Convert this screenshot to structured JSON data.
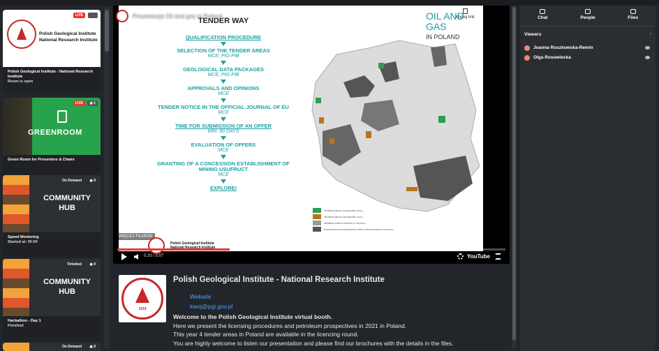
{
  "rail": {
    "cards": [
      {
        "title": "Polish Geological Institute - National Research Institute",
        "status": "Room is open",
        "badge": "LIVE",
        "count": "",
        "thumb_text": "Polish Geological Institute\nNational Research Institute"
      },
      {
        "title": "Green Room for Presenters & Chairs",
        "status": "",
        "badge": "LIVE",
        "count": "1",
        "thumb_text": "GREENROOM"
      },
      {
        "title": "Speed Mentoring",
        "status": "Started at: 00:00",
        "badge": "On Demand",
        "count": "0",
        "thumb_text": "COMMUNITY\nHUB"
      },
      {
        "title": "Hackathon - Day 1",
        "status": "Finished",
        "badge": "Finished",
        "count": "0",
        "thumb_text": "COMMUNITY\nHUB"
      },
      {
        "title": "",
        "status": "",
        "badge": "On Demand",
        "count": "0",
        "thumb_text": ""
      }
    ]
  },
  "video": {
    "yt_title": "Prezentacja Oil and gas in Poland",
    "copy_link": "Kopiuj link",
    "more_films": "WIĘCEJ FILMÓW",
    "time": "0:20 / 5:07",
    "progress_fraction": 0.29,
    "youtube": "YouTube",
    "corner_text": "Polish Geological Institute\nNational Research Institute",
    "slide": {
      "heading": "TENDER WAY",
      "brand_main": "OIL AND GAS",
      "brand_sub": "IN POLAND",
      "steps": [
        {
          "label": "QUALIFICATION PROCEDURE",
          "sub": "",
          "underline": true
        },
        {
          "label": "SELECTION OF THE TENDER AREAS",
          "sub": "MCE, PIG-PIB",
          "underline": false
        },
        {
          "label": "GEOLOGICAL DATA PACKAGES",
          "sub": "MCE, PIG-PIB",
          "underline": false
        },
        {
          "label": "APPROVALS AND OPINIONS",
          "sub": "MCE",
          "underline": false
        },
        {
          "label": "TENDER NOTICE IN THE OFFICIAL JOURNAL OF EU",
          "sub": "MCE",
          "underline": false
        },
        {
          "label": "TIME FOR SUBMISSION OF AN OFFER",
          "sub": "MIN. 90 DAYS",
          "underline": true
        },
        {
          "label": "EVALUATION OF OFFERS",
          "sub": "MCE",
          "underline": false
        },
        {
          "label": "GRANTING OF A CONCESSION ESTABLISHMENT OF MINING USUFRUCT",
          "sub": "MCE",
          "underline": false
        },
        {
          "label": "EXPLORE!",
          "sub": "",
          "underline": true
        }
      ],
      "legend": [
        "TENDER AREAS (5th ROUND, 2021)",
        "TENDER AREAS (4th ROUND, 2021)",
        "PENDING APPLICATIONS (31.08.2021)",
        "EXPLORATION AND PRODUCTION CONCESSIONS (31.08.2021)"
      ],
      "legend_colors": [
        "#2e9e4f",
        "#b8741f",
        "#9a9a9a",
        "#555555"
      ]
    }
  },
  "info": {
    "org_title": "Polish Geological Institute - National Research Institute",
    "website_label": "Website",
    "email": "kwoj@pgi.gov.pl",
    "logo_year": "1919",
    "welcome": "Welcome to the Polish Geological Institute virtual booth.",
    "lines": [
      "Here we present the licensing procedures and petroleum prospectives in 2021 in Poland.",
      "This year 4 tender areas in Poland are available in the licencing round.",
      "You are highly welcome to listen our presentation and please find our brochures with the details in the files."
    ]
  },
  "panel": {
    "tabs": [
      "Chat",
      "People",
      "Files"
    ],
    "viewers_label": "Viewers",
    "viewers": [
      "Joanna Roszkowska-Remin",
      "Olga Rosowiecka"
    ]
  },
  "colors": {
    "accent": "#1aa1a4",
    "live": "#e53935",
    "link": "#4da3ff"
  }
}
